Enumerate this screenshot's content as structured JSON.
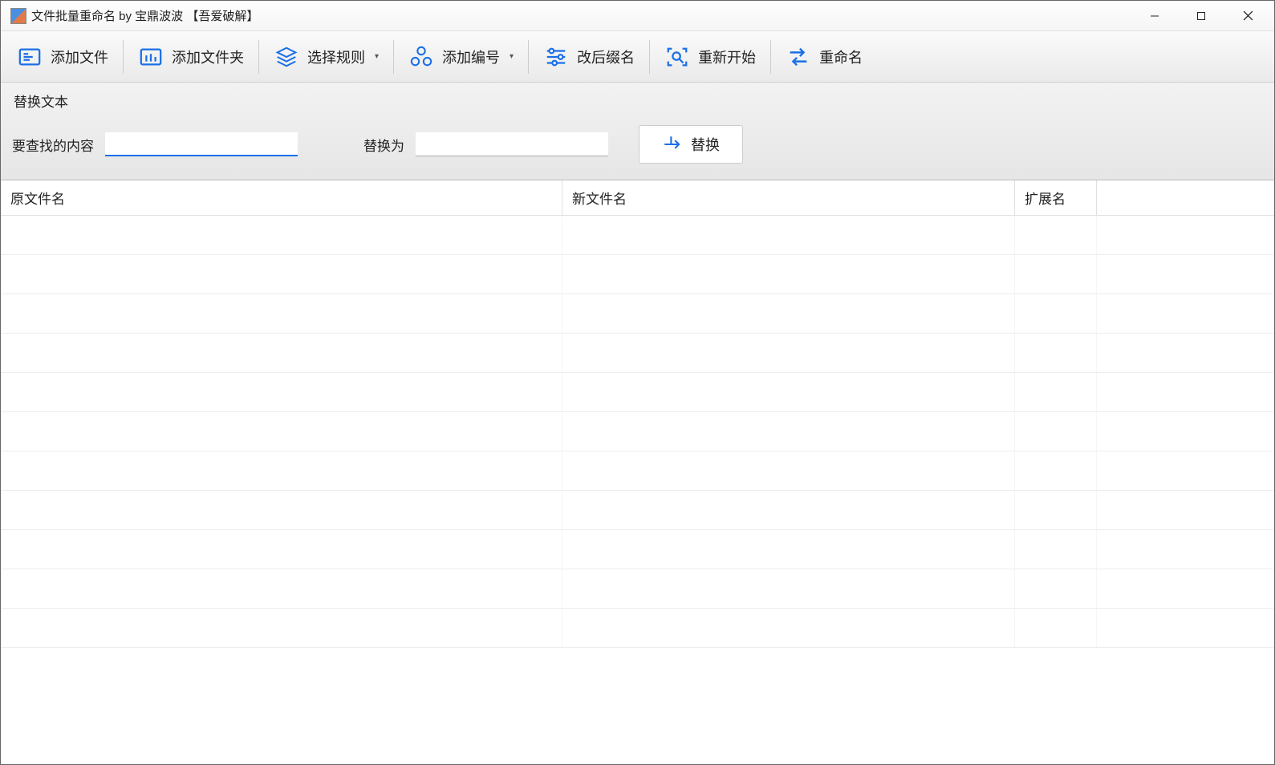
{
  "window": {
    "title": "文件批量重命名 by 宝鼎波波 【吾爱破解】"
  },
  "toolbar": {
    "add_file": "添加文件",
    "add_folder": "添加文件夹",
    "select_rule": "选择规则",
    "add_number": "添加编号",
    "change_ext": "改后缀名",
    "restart": "重新开始",
    "rename": "重命名"
  },
  "replace_panel": {
    "title": "替换文本",
    "find_label": "要查找的内容",
    "find_value": "",
    "replace_label": "替换为",
    "replace_value": "",
    "button_label": "替换"
  },
  "grid": {
    "columns": {
      "original": "原文件名",
      "new": "新文件名",
      "ext": "扩展名"
    },
    "rows": [
      {
        "original": "",
        "new": "",
        "ext": ""
      },
      {
        "original": "",
        "new": "",
        "ext": ""
      },
      {
        "original": "",
        "new": "",
        "ext": ""
      },
      {
        "original": "",
        "new": "",
        "ext": ""
      },
      {
        "original": "",
        "new": "",
        "ext": ""
      },
      {
        "original": "",
        "new": "",
        "ext": ""
      },
      {
        "original": "",
        "new": "",
        "ext": ""
      },
      {
        "original": "",
        "new": "",
        "ext": ""
      },
      {
        "original": "",
        "new": "",
        "ext": ""
      },
      {
        "original": "",
        "new": "",
        "ext": ""
      },
      {
        "original": "",
        "new": "",
        "ext": ""
      }
    ]
  }
}
